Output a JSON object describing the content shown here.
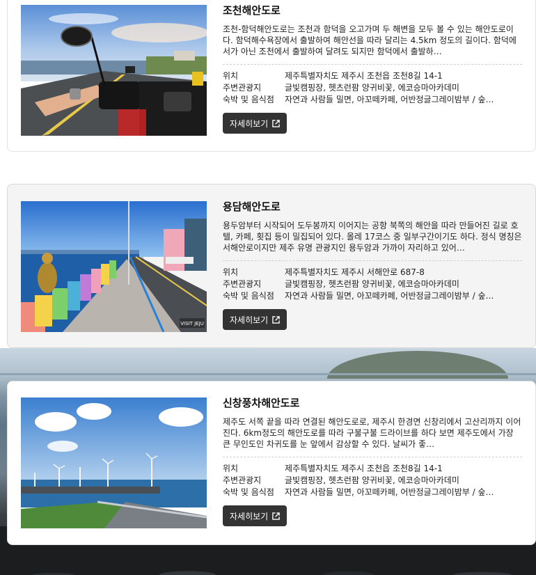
{
  "labels": {
    "location": "위치",
    "nearby": "주변관광지",
    "lodging": "숙박 및 음식점",
    "more": "자세히보기"
  },
  "cards": [
    {
      "title": "조천해안도로",
      "description": "조천-함덕해안도로는 조천과 함덕을 오고가며 두 해변을 모두 볼 수 있는 해안도로이다. 함덕해수욕장에서 출발하여 해안선을 따라 달리는 4.5km 정도의 길이다. 함덕에서가 아닌 조천에서 출발하여 달려도 되지만 함덕에서 출발하…",
      "location": "제주특별자치도 제주시 조천읍 조천8길 14-1",
      "nearby": "글빛캠핑장, 헷츠런팜 양귀비꽃, 에코승마아카데미",
      "lodging": "자연과 사람들 밀면, 아꼬떼카페, 어반정글그레이밤부 / 숲…",
      "image_icon": "scooter-coast-photo"
    },
    {
      "title": "용담해안도로",
      "description": "용두암부터 시작되어 도두봉까지 이어지는 공항 북쪽의 해안을 따라 만들어진 길로 호텔, 카페, 횟집 등이 밀집되어 있다. 올레 17코스 중 일부구간이기도 하다. 정식 명칭은 서해안로이지만 제주 유명 관광지인 용두암과 가까이 자리하고 있어…",
      "location": "제주특별자치도 제주시 서해안로 687-8",
      "nearby": "글빛캠핑장, 헷츠런팜 양귀비꽃, 에코승마아카데미",
      "lodging": "자연과 사람들 밀면, 아꼬떼카페, 어반정글그레이밤부 / 숲…",
      "image_icon": "mermaid-statue-coast-photo",
      "watermark": "VISIT JEJU"
    },
    {
      "title": "신창풍차해안도로",
      "description": "제주도 서쪽 끝을 따라 연결된 해안도로로, 제주시 한경면 신창리에서 고산리까지 이어진다. 6km정도의 해안도로를 따라 구불구불 드라이브를 하다 보면 제주도에서 가장 큰 무인도인 차귀도를 눈 앞에서 감상할 수 있다. 날씨가 좋…",
      "location": "제주특별자치도 제주시 조천읍 조천8길 14-1",
      "nearby": "글빛캠핑장, 헷츠런팜 양귀비꽃, 에코승마아카데미",
      "lodging": "자연과 사람들 밀면, 아꼬떼카페, 어반정글그레이밤부 / 숲…",
      "image_icon": "windmill-coast-photo"
    }
  ]
}
